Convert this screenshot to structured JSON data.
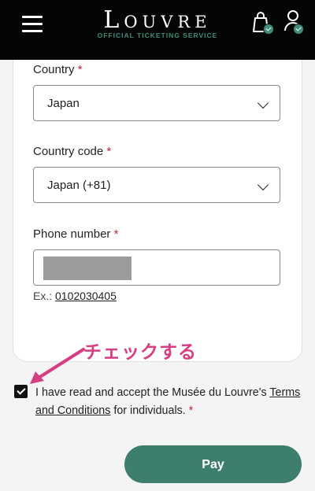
{
  "header": {
    "logo_title": "Louvre",
    "logo_subtitle": "OFFICIAL TICKETING SERVICE",
    "menu_icon": "hamburger-icon",
    "cart_icon": "shopping-bag-icon",
    "account_icon": "user-icon",
    "accent_color": "#3f8d7a"
  },
  "form": {
    "country": {
      "label": "Country",
      "required_mark": "*",
      "value": "Japan"
    },
    "country_code": {
      "label": "Country code",
      "required_mark": "*",
      "value": "Japan (+81)"
    },
    "phone": {
      "label": "Phone number",
      "required_mark": "*",
      "value": "",
      "hint_prefix": "Ex.:",
      "hint_example": "0102030405"
    }
  },
  "annotation": {
    "text": "チェックする",
    "color": "#d63d83"
  },
  "terms": {
    "text_before": "I have read and accept the Musée du Louvre's ",
    "link_text": "Terms and Conditions",
    "text_after": " for individuals.",
    "required_mark": "*",
    "checked": true
  },
  "pay_button": {
    "label": "Pay",
    "color": "#3d7f6c"
  }
}
